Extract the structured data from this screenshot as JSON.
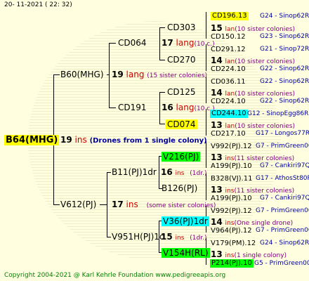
{
  "header": "20- 11-2021 ( 22: 32)",
  "footer": "Copyright 2004-2021 @ Karl Kehrle Foundation   www.pedigreeapis.org",
  "colors": {
    "bg": "#ffffe0",
    "yellow": "#ffff00",
    "cyan": "#00ffff",
    "green": "#00ff00",
    "red": "#cc0000",
    "blue": "#0000a0"
  },
  "root": {
    "name": "B64(MHG)",
    "num": "19",
    "lbl": "ins",
    "note": "(Drones from 1 single colony)"
  },
  "g1": [
    {
      "name": "B60(MHG)",
      "num": "19",
      "lbl": "lang",
      "note": "(15 sister colonies)"
    },
    {
      "name": "V612(PJ)",
      "num": "17",
      "lbl": "ins",
      "note": "(some sister colonies)"
    }
  ],
  "g2": [
    {
      "name": "CD064",
      "num": "17",
      "lbl": "lang",
      "note": "(10 c.)"
    },
    {
      "name": "CD191",
      "num": "16",
      "lbl": "lang",
      "note": "(10 c.)"
    },
    {
      "name": "B11(PJ)1dr",
      "num": "16",
      "lbl": "ins",
      "note": "(1dr.)"
    },
    {
      "name": "V951H(PJ)1c",
      "num": "15",
      "lbl": "ins",
      "note": "(1dr.)"
    }
  ],
  "g3": [
    {
      "name": "CD303"
    },
    {
      "name": "CD270"
    },
    {
      "name": "CD125"
    },
    {
      "name": "CD074"
    },
    {
      "name": "V216(PJ)"
    },
    {
      "name": "B126(PJ)"
    },
    {
      "name": "V36(PJ)1dr"
    },
    {
      "name": "V154H(RL)"
    }
  ],
  "g4": [
    {
      "top": "CD196.13",
      "num": "15",
      "lbl": "lan",
      "note": "(10 sister colonies)",
      "bot": "CD150.12",
      "tr": "G24 - Sinop62R",
      "br": "G23 - Sinop62R"
    },
    {
      "top": "CD291.12",
      "num": "14",
      "lbl": "lan",
      "note": "(10 sister colonies)",
      "bot": "CD224.10",
      "tr": "G21 - Sinop72R",
      "br": "G22 - Sinop62R"
    },
    {
      "top": "CD036.11",
      "num": "14",
      "lbl": "lan",
      "note": "(10 sister colonies)",
      "bot": "CD224.10",
      "tr": "G22 - Sinop62R",
      "br": "G22 - Sinop62R"
    },
    {
      "top": "CD244.10",
      "num": "13",
      "lbl": "lan",
      "note": "(10 sister colonies)",
      "bot": "CD217.10",
      "tr": "G12 - SinopEgg86R",
      "br": "G17 - Longos77R"
    },
    {
      "top": "V992(PJ).12",
      "num": "13",
      "lbl": "ins",
      "note": "(11 sister colonies)",
      "bot": "A199(PJ).10",
      "tr": "G7 - PrimGreen00",
      "br": "G7 - Cankiri97Q"
    },
    {
      "top": "B328(VJ).11",
      "num": "13",
      "lbl": "ins",
      "note": "(11 sister colonies)",
      "bot": "A199(PJ).10",
      "tr": "G17 - AthosSt80R",
      "br": "G7 - Cankiri97Q"
    },
    {
      "top": "V992(PJ).12",
      "num": "14",
      "lbl": "ins",
      "note": "(One single drone)",
      "bot": "V964(PJ).12",
      "tr": "G7 - PrimGreen00",
      "br": "G7 - PrimGreen00"
    },
    {
      "top": "V179(PM).12",
      "num": "13",
      "lbl": "ins",
      "note": "(1 single colony)",
      "bot": "P214(PJ).10",
      "tr": "G24 - Sinop62R",
      "br": "G5 - PrimGreen00"
    }
  ]
}
